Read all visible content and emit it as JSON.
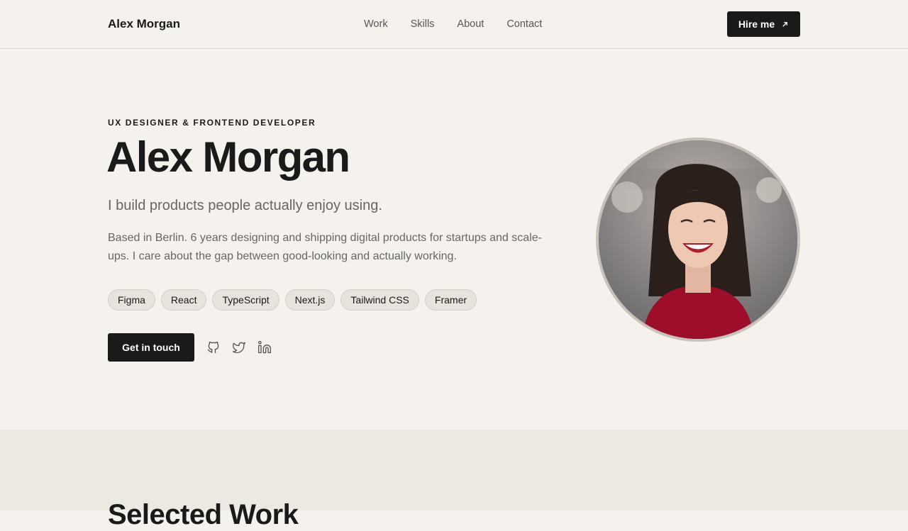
{
  "nav": {
    "brand": "Alex Morgan",
    "links": [
      "Work",
      "Skills",
      "About",
      "Contact"
    ],
    "hire_label": "Hire me"
  },
  "hero": {
    "eyebrow": "UX DESIGNER & FRONTEND DEVELOPER",
    "name": "Alex Morgan",
    "tagline": "I build products people actually enjoy using.",
    "bio": "Based in Berlin. 6 years designing and shipping digital products for startups and scale-ups. I care about the gap between good-looking and actually working.",
    "tags": [
      "Figma",
      "React",
      "TypeScript",
      "Next.js",
      "Tailwind CSS",
      "Framer"
    ],
    "cta_label": "Get in touch",
    "social_icons": [
      "github-icon",
      "twitter-icon",
      "linkedin-icon"
    ]
  },
  "work": {
    "title": "Selected Work"
  },
  "colors": {
    "background": "#f5f2ee",
    "section_alt": "#ece8e2",
    "accent_dark": "#1a1a1a",
    "muted_text": "#666666",
    "tag_fill": "#e8e3dd"
  }
}
